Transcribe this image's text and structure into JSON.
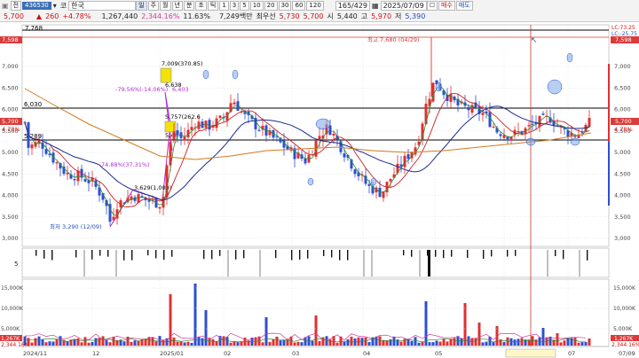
{
  "toolbar": {
    "row1": {
      "mode": "전",
      "code": "436530",
      "market": "코",
      "name": "한국",
      "periods": [
        "주",
        "월",
        "년",
        "분",
        "초",
        "틱"
      ],
      "minutes": [
        "1",
        "3",
        "5",
        "10",
        "20",
        "30",
        "60",
        "120"
      ],
      "count": "165/429",
      "date": "2025/07/09",
      "actions": [
        "☐",
        "매수",
        "매도"
      ]
    },
    "row2": {
      "price": "5,700",
      "change": "260",
      "change_pct": "+4.78%",
      "volume": "1,267,440",
      "vol_ratio": "2,344.16%",
      "turnover": "11.63%",
      "amount": "7,249백만",
      "label_prev": "최우선",
      "open_label": "시",
      "bid": "5,730",
      "ask": "5,700",
      "open": "5,440",
      "high_label": "고",
      "high": "5,970",
      "low_label": "저",
      "low": "5,390"
    }
  },
  "price_axis": {
    "ticks": [
      "7,000",
      "6,500",
      "6,000",
      "5,500",
      "5,000",
      "4,500",
      "4,000",
      "3,500",
      "3,000"
    ],
    "top_badge": "7,598",
    "right_top_badge": "7,598",
    "current_badge": "5,700",
    "current_pct": "4.78%",
    "ma_legend": [
      "LC:73.25",
      "LC:-25.75"
    ]
  },
  "price_labels": {
    "line_top": "7,768",
    "line_6030": "6,030",
    "line_5289": "5,289",
    "high_annot": "최고 7,680 (04/29)",
    "low_annot": "최저 3,290 (12/09)",
    "box_hi": "7,009(370.85)",
    "fib_low_pct": "-79.56%(-14,06%)",
    "fib_mid": "6,403",
    "box_mid": "5,757(262.6",
    "box_mid2": "6,638",
    "box_mid3": "5,48",
    "fib_left": "74.88%(37.31%)",
    "box_low": "3,629(1,000)"
  },
  "indicator": {
    "label": "5"
  },
  "volume_axis": {
    "ticks": [
      "15,000K",
      "10,000K",
      "5,000K"
    ],
    "left_ticks": [
      "15,000K",
      "10,000K",
      "5,000K"
    ],
    "current_badge": "1,267K",
    "badge_small": "2,344.16%"
  },
  "date_axis": {
    "labels": [
      "2024/11",
      "12",
      "2025/01",
      "02",
      "03",
      "04",
      "05",
      "2025/06/16(월)",
      "07",
      "07/09"
    ]
  },
  "colors": {
    "up": "#e03030",
    "down": "#2d4fd0",
    "ma5": "#2c8a2c",
    "ma20": "#c92424",
    "ma60": "#1c2b8f",
    "ma120": "#d27a1e",
    "fib": "#b42bd6",
    "box": "#f2e20a"
  }
}
